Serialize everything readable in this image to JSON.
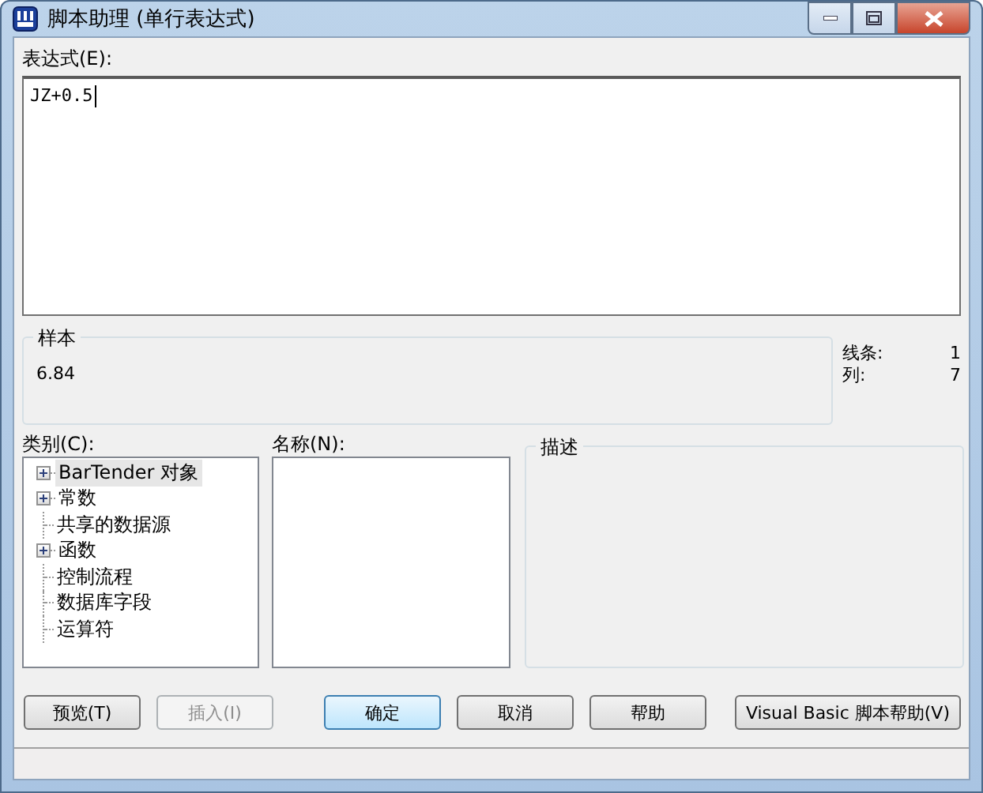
{
  "window": {
    "title": "脚本助理 (单行表达式)"
  },
  "expression": {
    "label": "表达式(E):",
    "value": "JZ+0.5"
  },
  "sample": {
    "legend": "样本",
    "value": "6.84"
  },
  "position": [
    {
      "label": "线条:",
      "value": "1"
    },
    {
      "label": "列:",
      "value": "7"
    }
  ],
  "category": {
    "label": "类别(C):",
    "items": [
      {
        "label": "BarTender 对象",
        "expandable": true,
        "selected": true
      },
      {
        "label": "常数",
        "expandable": true,
        "selected": false
      },
      {
        "label": "共享的数据源",
        "expandable": false,
        "selected": false
      },
      {
        "label": "函数",
        "expandable": true,
        "selected": false
      },
      {
        "label": "控制流程",
        "expandable": false,
        "selected": false
      },
      {
        "label": "数据库字段",
        "expandable": false,
        "selected": false
      },
      {
        "label": "运算符",
        "expandable": false,
        "selected": false
      }
    ]
  },
  "name": {
    "label": "名称(N):"
  },
  "description": {
    "legend": "描述"
  },
  "buttons": [
    {
      "label": "预览(T)",
      "disabled": false,
      "default": false
    },
    {
      "label": "插入(I)",
      "disabled": true,
      "default": false
    },
    {
      "label": "确定",
      "disabled": false,
      "default": true
    },
    {
      "label": "取消",
      "disabled": false,
      "default": false
    },
    {
      "label": "帮助",
      "disabled": false,
      "default": false
    },
    {
      "label": "Visual Basic 脚本帮助(V)",
      "disabled": false,
      "default": false
    }
  ]
}
